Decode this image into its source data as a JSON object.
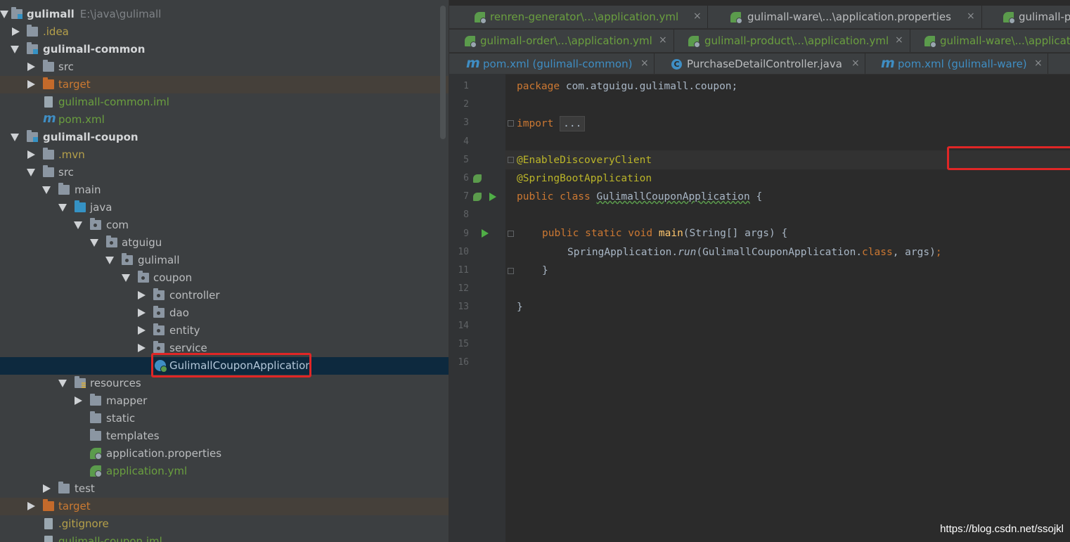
{
  "tree": {
    "root_label": "gulimall",
    "root_path": "E:\\java\\gulimall",
    "idea": ".idea",
    "common_module": "gulimall-common",
    "common_src": "src",
    "common_target": "target",
    "common_iml": "gulimall-common.iml",
    "common_pom": "pom.xml",
    "coupon_module": "gulimall-coupon",
    "mvn": ".mvn",
    "src": "src",
    "main": "main",
    "java": "java",
    "com": "com",
    "atguigu": "atguigu",
    "gulimall_pkg": "gulimall",
    "coupon_pkg": "coupon",
    "controller": "controller",
    "dao": "dao",
    "entity": "entity",
    "service": "service",
    "app_class": "GulimallCouponApplication",
    "resources": "resources",
    "mapper": "mapper",
    "static": "static",
    "templates": "templates",
    "app_properties": "application.properties",
    "app_yml": "application.yml",
    "test": "test",
    "coupon_target": "target",
    "gitignore": ".gitignore",
    "coupon_iml": "gulimall-coupon.iml"
  },
  "tabs": {
    "row1": [
      {
        "label": "renren-generator\\...\\application.yml",
        "icon": "spring-config-icon"
      },
      {
        "label": "gulimall-ware\\...\\application.properties",
        "icon": "spring-config-icon"
      },
      {
        "label": "gulimall-p",
        "icon": "spring-config-icon"
      }
    ],
    "row2": [
      {
        "label": "gulimall-order\\...\\application.yml",
        "icon": "spring-config-icon"
      },
      {
        "label": "gulimall-product\\...\\application.yml",
        "icon": "spring-config-icon"
      },
      {
        "label": "gulimall-ware\\...\\applicati",
        "icon": "spring-config-icon"
      }
    ],
    "row3": [
      {
        "label": "pom.xml (gulimall-common)",
        "icon": "maven-icon"
      },
      {
        "label": "PurchaseDetailController.java",
        "icon": "class-icon"
      },
      {
        "label": "pom.xml (gulimall-ware)",
        "icon": "maven-icon"
      }
    ],
    "close_glyph": "×",
    "maven_glyph": "m",
    "class_glyph": "C"
  },
  "editor": {
    "line_numbers": [
      "1",
      "2",
      "3",
      "4",
      "5",
      "6",
      "7",
      "8",
      "9",
      "10",
      "11",
      "12",
      "13",
      "14",
      "15",
      "16"
    ],
    "kw_package": "package",
    "package_name": " com.atguigu.gulimall.coupon;",
    "kw_import": "import",
    "folded_import": "...",
    "ann_discovery": "@EnableDiscoveryClient",
    "ann_boot": "@SpringBootApplication",
    "kw_public_class": "public class",
    "class_name": "GulimallCouponApplication",
    "class_open": " {",
    "kw_public_static_void": "public static void",
    "method_main": "main",
    "main_params": "(String[] args) {",
    "spring_app": "SpringApplication.",
    "run_call": "run",
    "run_args_a": "(GulimallCouponApplication.",
    "kw_class": "class",
    "run_args_b": ", args)",
    "semicolon": ";",
    "close_inner": "}",
    "close_outer": "}"
  },
  "watermark": "https://blog.csdn.net/ssojkl",
  "colors": {
    "highlight_box": "#e02626",
    "keyword": "#cc7832",
    "annotation": "#bbb529",
    "method": "#ffc66d"
  }
}
